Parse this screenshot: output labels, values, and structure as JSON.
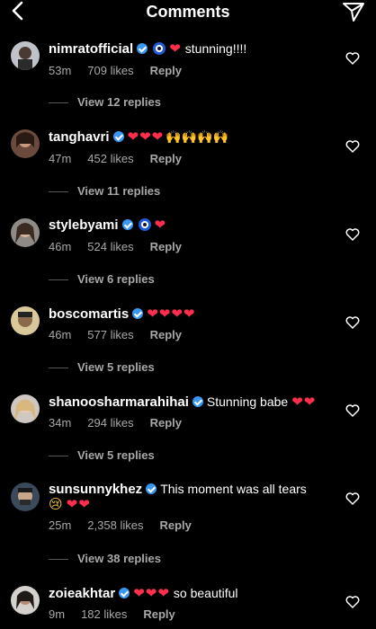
{
  "header": {
    "title": "Comments"
  },
  "comments": [
    {
      "username": "nimratofficial",
      "text": "stunning!!!!",
      "time": "53m",
      "likes": "709 likes",
      "reply": "Reply",
      "view_replies": "View 12 replies"
    },
    {
      "username": "tanghavri",
      "text": "",
      "time": "47m",
      "likes": "452 likes",
      "reply": "Reply",
      "view_replies": "View 11 replies"
    },
    {
      "username": "stylebyami",
      "text": "",
      "time": "46m",
      "likes": "524 likes",
      "reply": "Reply",
      "view_replies": "View 6 replies"
    },
    {
      "username": "boscomartis",
      "text": "",
      "time": "46m",
      "likes": "577 likes",
      "reply": "Reply",
      "view_replies": "View 5 replies"
    },
    {
      "username": "shanoosharmarahihai",
      "text": "Stunning babe",
      "time": "34m",
      "likes": "294 likes",
      "reply": "Reply",
      "view_replies": "View 5 replies"
    },
    {
      "username": "sunsunnykhez",
      "text": "This moment was all tears",
      "time": "25m",
      "likes": "2,358 likes",
      "reply": "Reply",
      "view_replies": "View 38 replies"
    },
    {
      "username": "zoieakhtar",
      "text": "so beautiful",
      "time": "9m",
      "likes": "182 likes",
      "reply": "Reply"
    }
  ],
  "colors": {
    "background": "#000000",
    "heart": "#ff2e4d",
    "verified": "#3897f0",
    "secondary_text": "#a8a8a8"
  },
  "icons": {
    "back": "chevron-left-icon",
    "send": "paper-plane-icon",
    "like": "heart-outline-icon",
    "verified": "verified-badge-icon"
  }
}
